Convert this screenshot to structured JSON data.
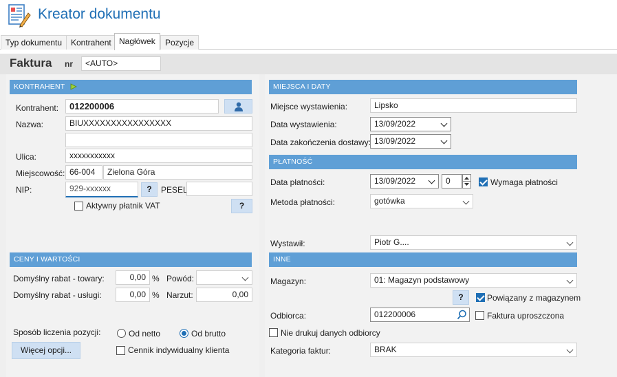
{
  "app": {
    "title": "Kreator dokumentu"
  },
  "tabs": [
    {
      "label": "Typ dokumentu",
      "active": false
    },
    {
      "label": "Kontrahent",
      "active": false
    },
    {
      "label": "Nagłówek",
      "active": true
    },
    {
      "label": "Pozycje",
      "active": false
    }
  ],
  "document": {
    "type": "Faktura",
    "nr_label": "nr",
    "nr_value": "<AUTO>"
  },
  "kontrahent": {
    "section": "KONTRAHENT",
    "kontrahent_label": "Kontrahent:",
    "kontrahent_value": "012200006",
    "nazwa_label": "Nazwa:",
    "nazwa_value": "BIUXXXXXXXXXXXXXXXX",
    "nazwa2_value": "",
    "ulica_label": "Ulica:",
    "ulica_value": "xxxxxxxxxxx",
    "miejscowosc_label": "Miejscowość:",
    "kod_value": "66-004",
    "miasto_value": "Zielona Góra",
    "nip_label": "NIP:",
    "nip_value": "929-xxxxxx",
    "pesel_label": "PESEL:",
    "pesel_value": "",
    "help_label": "?",
    "vat_label": "Aktywny płatnik VAT",
    "vat_checked": false
  },
  "ceny": {
    "section": "CENY I WARTOŚCI",
    "rabat_towary_label": "Domyślny rabat - towary:",
    "rabat_towary_value": "0,00",
    "rabat_uslugi_label": "Domyślny rabat - usługi:",
    "rabat_uslugi_value": "0,00",
    "percent": "%",
    "powod_label": "Powód:",
    "powod_value": "",
    "narzut_label": "Narzut:",
    "narzut_value": "0,00",
    "sposob_label": "Sposób liczenia pozycji:",
    "od_netto": "Od netto",
    "od_brutto": "Od brutto",
    "selected": "Od brutto",
    "more_options": "Więcej opcji...",
    "cennik_label": "Cennik indywidualny klienta",
    "cennik_checked": false
  },
  "miejsca": {
    "section": "MIEJSCA I DATY",
    "miejsce_label": "Miejsce wystawienia:",
    "miejsce_value": "Lipsko",
    "data_wyst_label": "Data wystawienia:",
    "data_wyst_value": "13/09/2022",
    "data_zak_label": "Data zakończenia dostawy:",
    "data_zak_value": "13/09/2022"
  },
  "platnosc": {
    "section": "PŁATNOŚĆ",
    "data_label": "Data płatności:",
    "data_value": "13/09/2022",
    "days_value": "0",
    "wymaga_label": "Wymaga płatności",
    "wymaga_checked": true,
    "metoda_label": "Metoda płatności:",
    "metoda_value": "gotówka",
    "wystawil_label": "Wystawił:",
    "wystawil_value": "Piotr G...."
  },
  "inne": {
    "section": "INNE",
    "magazyn_label": "Magazyn:",
    "magazyn_value": "01: Magazyn podstawowy",
    "help_label": "?",
    "powiazany_label": "Powiązany z magazynem",
    "powiazany_checked": true,
    "odbiorca_label": "Odbiorca:",
    "odbiorca_value": "012200006",
    "faktura_upr_label": "Faktura uproszczona",
    "faktura_upr_checked": false,
    "nie_drukuj_label": "Nie drukuj danych odbiorcy",
    "nie_drukuj_checked": false,
    "kategoria_label": "Kategoria faktur:",
    "kategoria_value": "BRAK"
  },
  "colors": {
    "accent": "#1f6fb5",
    "section": "#5f9fd6",
    "button": "#cfe0f3"
  }
}
